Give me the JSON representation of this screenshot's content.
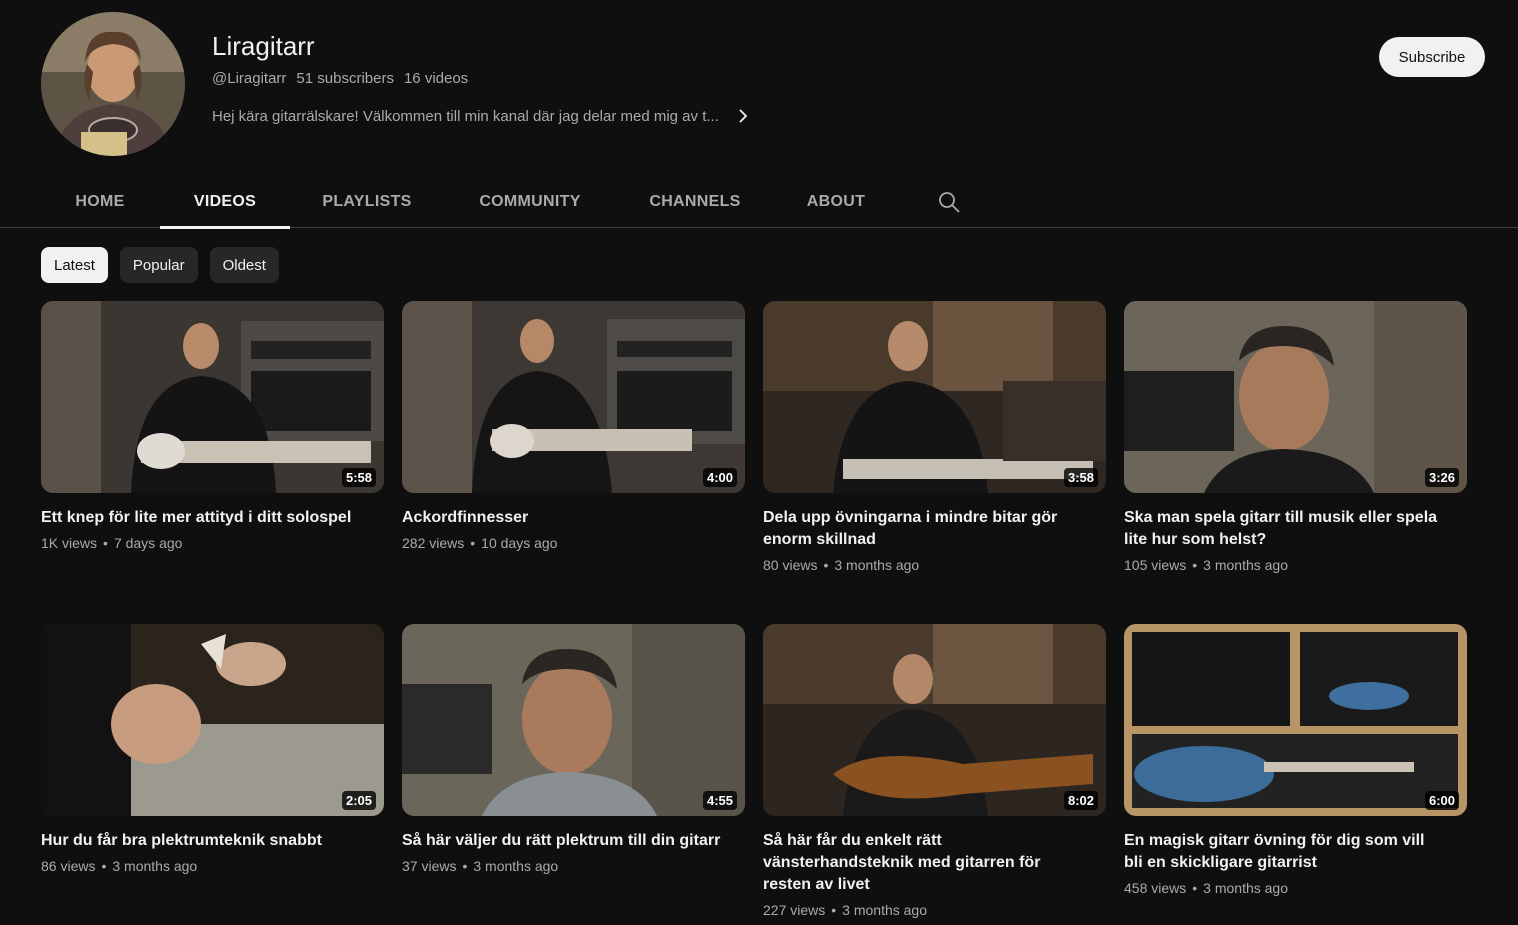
{
  "channel": {
    "name": "Liragitarr",
    "handle": "@Liragitarr",
    "subscribers": "51 subscribers",
    "videos_count": "16 videos",
    "description": "Hej kära gitarrälskare! Välkommen till min kanal där jag delar med mig av t...",
    "subscribe_label": "Subscribe"
  },
  "tabs": [
    {
      "label": "HOME"
    },
    {
      "label": "VIDEOS"
    },
    {
      "label": "PLAYLISTS"
    },
    {
      "label": "COMMUNITY"
    },
    {
      "label": "CHANNELS"
    },
    {
      "label": "ABOUT"
    }
  ],
  "active_tab": "VIDEOS",
  "chips": [
    {
      "label": "Latest"
    },
    {
      "label": "Popular"
    },
    {
      "label": "Oldest"
    }
  ],
  "videos": [
    {
      "title": "Ett knep för lite mer attityd i ditt solospel",
      "views": "1K views",
      "age": "7 days ago",
      "duration": "5:58"
    },
    {
      "title": "Ackordfinnesser",
      "views": "282 views",
      "age": "10 days ago",
      "duration": "4:00"
    },
    {
      "title": "Dela upp övningarna i mindre bitar gör enorm skillnad",
      "views": "80 views",
      "age": "3 months ago",
      "duration": "3:58"
    },
    {
      "title": "Ska man spela gitarr till musik eller spela lite hur som helst?",
      "views": "105 views",
      "age": "3 months ago",
      "duration": "3:26"
    },
    {
      "title": "Hur du får bra plektrumteknik snabbt",
      "views": "86 views",
      "age": "3 months ago",
      "duration": "2:05"
    },
    {
      "title": "Så här väljer du rätt plektrum till din gitarr",
      "views": "37 views",
      "age": "3 months ago",
      "duration": "4:55"
    },
    {
      "title": "Så här får du enkelt rätt vänsterhandsteknik med gitarren för resten av livet",
      "views": "227 views",
      "age": "3 months ago",
      "duration": "8:02"
    },
    {
      "title": "En magisk gitarr övning för dig som vill bli en skickligare gitarrist",
      "views": "458 views",
      "age": "3 months ago",
      "duration": "6:00"
    }
  ],
  "colors": {
    "background": "#0f0f0f",
    "text_primary": "#f1f1f1",
    "text_secondary": "#aaaaaa",
    "chip_bg": "#272727"
  }
}
